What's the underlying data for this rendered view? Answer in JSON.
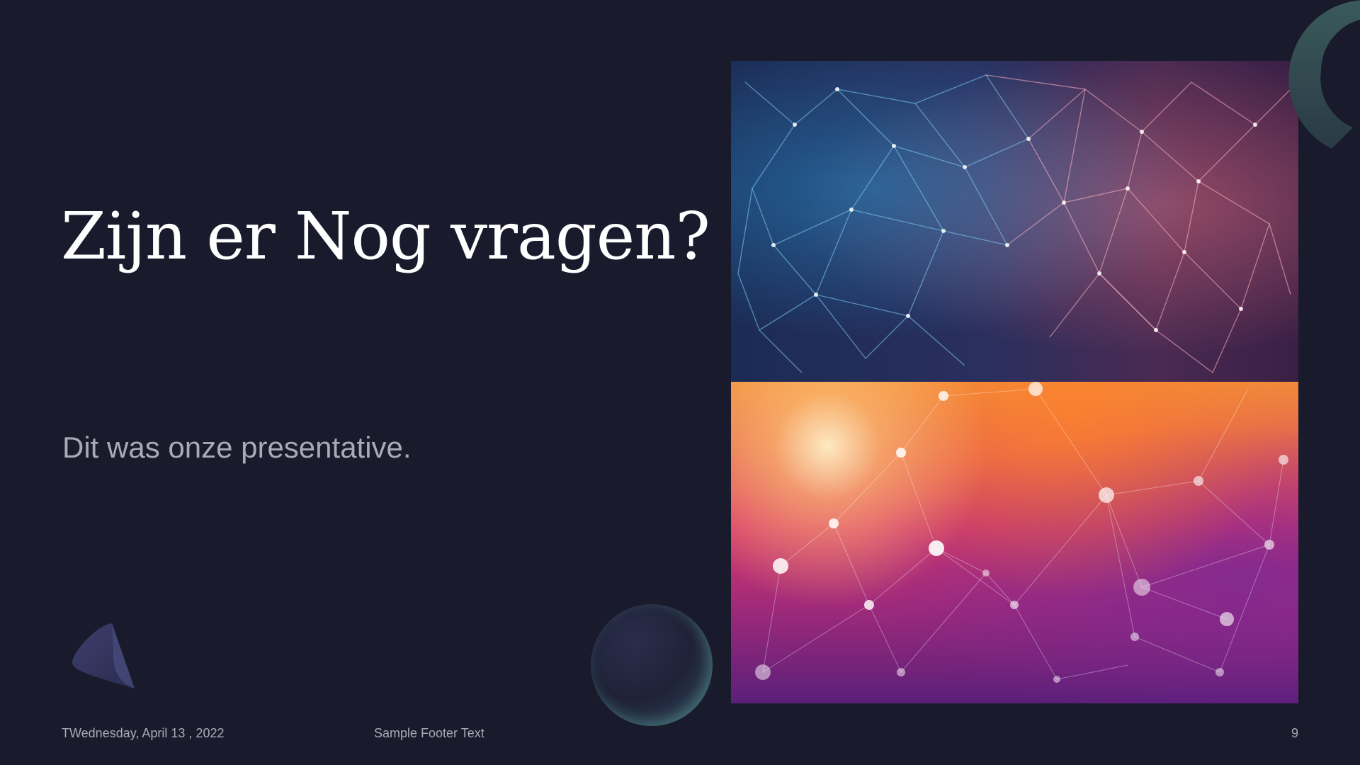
{
  "slide": {
    "title": "Zijn er Nog vragen?",
    "subtitle": "Dit was onze presentative.",
    "footer": {
      "date": "TWednesday, April 13 , 2022",
      "text": "Sample Footer Text",
      "page_number": "9"
    },
    "images": [
      {
        "name": "network-blue-pink-image"
      },
      {
        "name": "network-orange-purple-image"
      }
    ]
  },
  "colors": {
    "background": "#1a1a2d",
    "title": "#ffffff",
    "subtitle": "#a9a9b8"
  }
}
